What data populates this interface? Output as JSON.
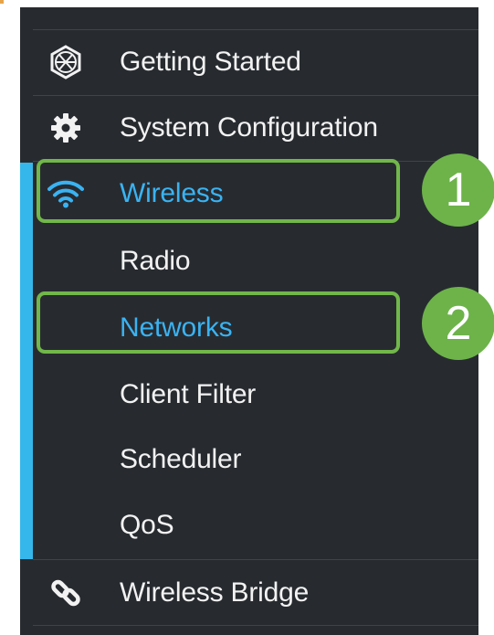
{
  "colors": {
    "panel_bg": "#272b30",
    "accent": "#35b7eb",
    "active_text": "#3ab3f2",
    "highlight": "#71b74a"
  },
  "nav": {
    "getting_started": "Getting Started",
    "system_configuration": "System Configuration",
    "wireless": "Wireless",
    "radio": "Radio",
    "networks": "Networks",
    "client_filter": "Client Filter",
    "scheduler": "Scheduler",
    "qos": "QoS",
    "wireless_bridge": "Wireless Bridge"
  },
  "icons": {
    "getting_started": "globe-icon",
    "system_configuration": "gear-icon",
    "wireless": "wifi-icon",
    "wireless_bridge": "link-icon"
  },
  "annotations": {
    "step1": "1",
    "step2": "2"
  }
}
